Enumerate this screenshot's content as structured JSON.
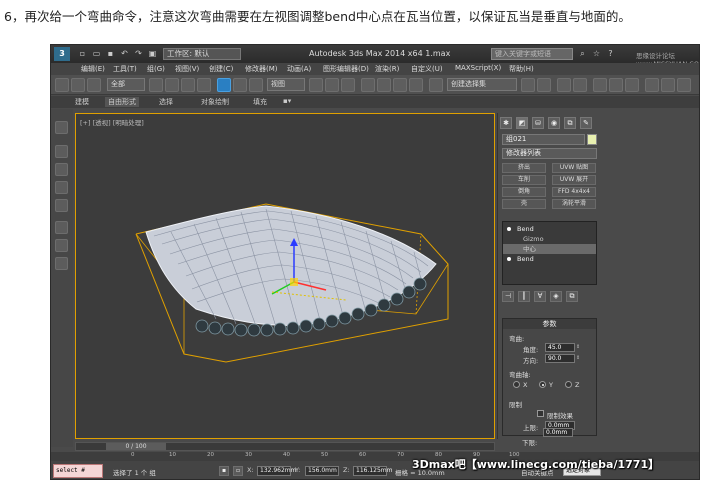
{
  "caption": "6，再次给一个弯曲命令，注意这次弯曲需要在左视图调整bend中心点在瓦当位置，以保证瓦当是垂直与地面的。",
  "titlebar": {
    "logo": "3",
    "workspace": "工作区: 默认",
    "title": "Autodesk 3ds Max  2014 x64     1.max",
    "search_placeholder": "键入关键字或短语",
    "site": "思缘设计论坛 www.MISSYUAN.COM"
  },
  "menus": [
    "编辑(E)",
    "工具(T)",
    "组(G)",
    "视图(V)",
    "创建(C)",
    "修改器(M)",
    "动画(A)",
    "图形编辑器(D)",
    "渲染(R)",
    "自定义(U)",
    "MAXScript(X)",
    "帮助(H)"
  ],
  "toolbar": {
    "ref_coord": "视图",
    "selection_set": "创建选择集"
  },
  "ribbon_tabs": [
    "建模",
    "自由形式",
    "选择",
    "对象绘制",
    "填充"
  ],
  "viewport": {
    "label": "[+] [透视] [明暗处理]"
  },
  "command_panel": {
    "tabs": [
      "✱",
      "◩",
      "⛁",
      "◉",
      "⧉",
      "✎"
    ],
    "object_name": "组021",
    "modifier_list": "修改器列表",
    "buttons": [
      "挤出",
      "UVW 贴图",
      "车削",
      "UVW 展开",
      "倒角",
      "FFD 4x4x4",
      "壳",
      "涡轮平滑"
    ],
    "stack": [
      {
        "label": "Bend",
        "level": 0,
        "selected": false
      },
      {
        "label": "Gizmo",
        "level": 1,
        "selected": false
      },
      {
        "label": "中心",
        "level": 1,
        "selected": true
      },
      {
        "label": "Bend",
        "level": 0,
        "selected": false
      }
    ],
    "stack_buttons": [
      "⊣",
      "┃",
      "∀",
      "◈",
      "⧉"
    ],
    "params": {
      "title": "参数",
      "bend_label": "弯曲:",
      "angle_label": "角度:",
      "angle_value": "45.0",
      "direction_label": "方向:",
      "direction_value": "90.0",
      "axis_label": "弯曲轴:",
      "axis_options": [
        "X",
        "Y",
        "Z"
      ],
      "axis_selected": "Y",
      "limit_label": "限制",
      "limit_effect": "限制效果",
      "upper_label": "上限:",
      "upper_value": "0.0mm",
      "lower_label": "下限:",
      "lower_value": "0.0mm"
    }
  },
  "timeline": {
    "slider": "0 / 100",
    "ticks": [
      "0",
      "10",
      "20",
      "30",
      "40",
      "50",
      "60",
      "70",
      "80",
      "90",
      "100"
    ]
  },
  "status": {
    "script": "select #($Line",
    "selected": "选择了 1 个 组",
    "x_label": "X:",
    "x_value": "132.962mm",
    "y_label": "Y:",
    "y_value": "156.0mm",
    "z_label": "Z:",
    "z_value": "116.125mm",
    "grid": "栅格 = 10.0mm",
    "auto_key": "自动关键点",
    "set_key": "选定对象"
  },
  "watermark": "3Dmax吧【www.linecg.com/tieba/1771】",
  "colors": {
    "viewport_border": "#e0a000",
    "ui_dark": "#4a4a4a",
    "mesh": "#d8dde8"
  }
}
